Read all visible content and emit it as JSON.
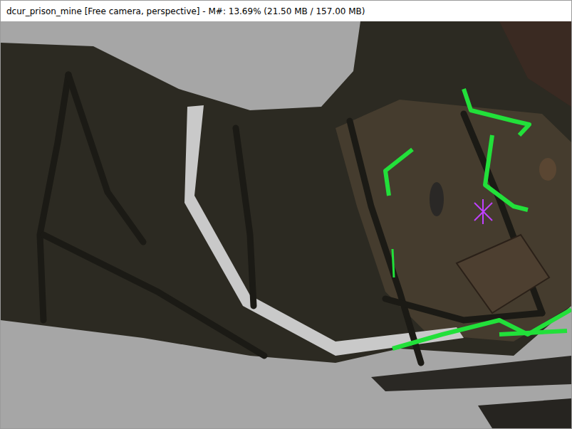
{
  "window": {
    "title": "dcur_prison_mine [Free camera, perspective] - M#: 13.69% (21.50 MB / 157.00 MB)"
  }
}
